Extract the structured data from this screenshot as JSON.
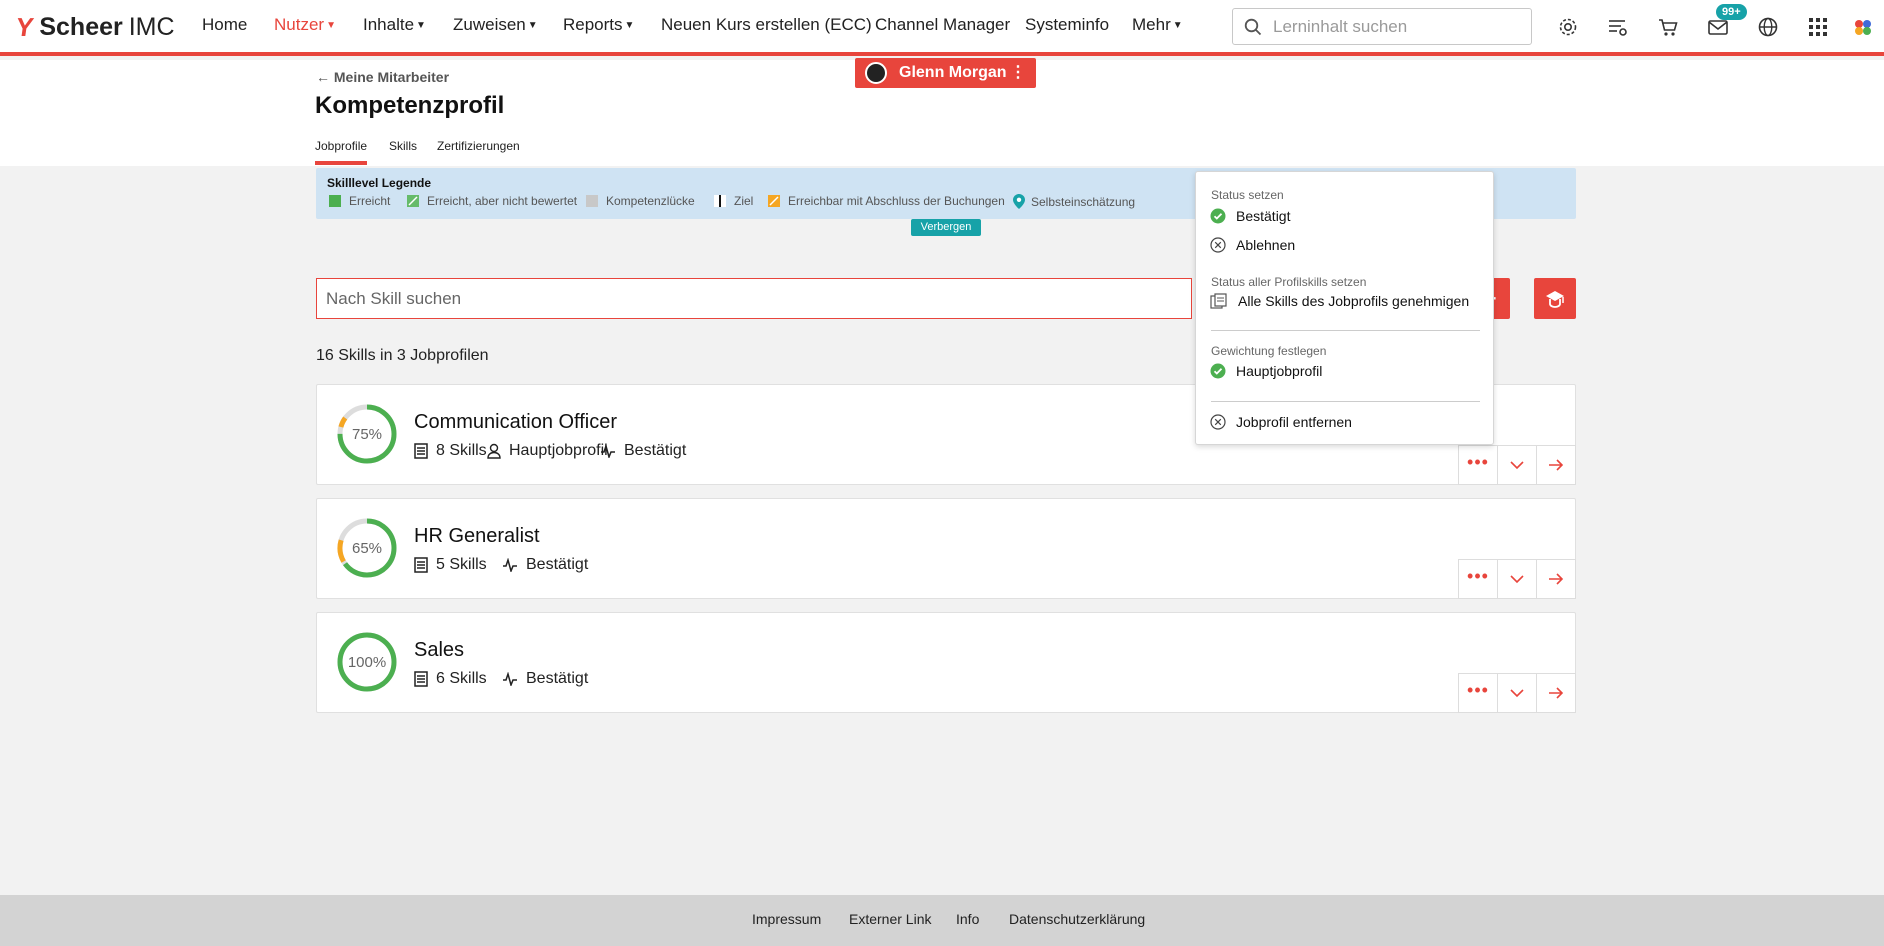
{
  "brand": {
    "word1": "Scheer",
    "word2": "IMC"
  },
  "nav": {
    "items": [
      {
        "label": "Home"
      },
      {
        "label": "Nutzer"
      },
      {
        "label": "Inhalte"
      },
      {
        "label": "Zuweisen"
      },
      {
        "label": "Reports"
      },
      {
        "label": "Neuen Kurs erstellen (ECC)"
      },
      {
        "label": "Channel Manager"
      },
      {
        "label": "Systeminfo"
      },
      {
        "label": "Mehr"
      }
    ],
    "search_placeholder": "Lerninhalt suchen",
    "messages_badge": "99+",
    "accent_color": "#e8453c",
    "icons": [
      "gear-icon",
      "playlist-icon",
      "cart-icon",
      "mail-icon",
      "globe-icon",
      "apps-grid-icon"
    ]
  },
  "header": {
    "back_label": "Meine Mitarbeiter",
    "title": "Kompetenzprofil",
    "tabs": [
      {
        "label": "Jobprofile"
      },
      {
        "label": "Skills"
      },
      {
        "label": "Zertifizierungen"
      }
    ],
    "active_tab": "Jobprofile",
    "user_name": "Glenn Morgan",
    "user_menu_glyph": "⋮"
  },
  "legend": {
    "title": "Skilllevel Legende",
    "items": [
      {
        "label": "Erreicht",
        "color": "#4caf50"
      },
      {
        "label": "Erreicht, aber nicht bewertet",
        "color": "#66bb6a"
      },
      {
        "label": "Kompetenzlücke",
        "color": "#c8c8c8"
      },
      {
        "label": "Ziel",
        "color": "#111111"
      },
      {
        "label": "Erreichbar mit Abschluss der Buchungen",
        "color": "#f5a623"
      },
      {
        "label": "Selbsteinschätzung",
        "color": "#17a2a8"
      }
    ],
    "hide_label": "Verbergen"
  },
  "skill_search": {
    "placeholder": "Nach Skill suchen"
  },
  "summary": "16 Skills in 3 Jobprofilen",
  "jobprofiles": [
    {
      "title": "Communication Officer",
      "percent": "75%",
      "progress": 0.75,
      "skills": "8 Skills",
      "main": "Hauptjobprofil",
      "status": "Bestätigt"
    },
    {
      "title": "HR Generalist",
      "percent": "65%",
      "progress": 0.65,
      "skills": "5 Skills",
      "status": "Bestätigt"
    },
    {
      "title": "Sales",
      "percent": "100%",
      "progress": 1.0,
      "skills": "6 Skills",
      "status": "Bestätigt"
    }
  ],
  "dropdown": {
    "head_status": "Status setzen",
    "confirm": "Bestätigt",
    "reject": "Ablehnen",
    "head_all": "Status aller Profilskills setzen",
    "approve_all": "Alle Skills des Jobprofils genehmigen",
    "head_weight": "Gewichtung festlegen",
    "main_profile": "Hauptjobprofil",
    "remove": "Jobprofil entfernen"
  },
  "footer": {
    "links": [
      {
        "label": "Impressum"
      },
      {
        "label": "Externer Link"
      },
      {
        "label": "Info"
      },
      {
        "label": "Datenschutzerklärung"
      }
    ]
  }
}
